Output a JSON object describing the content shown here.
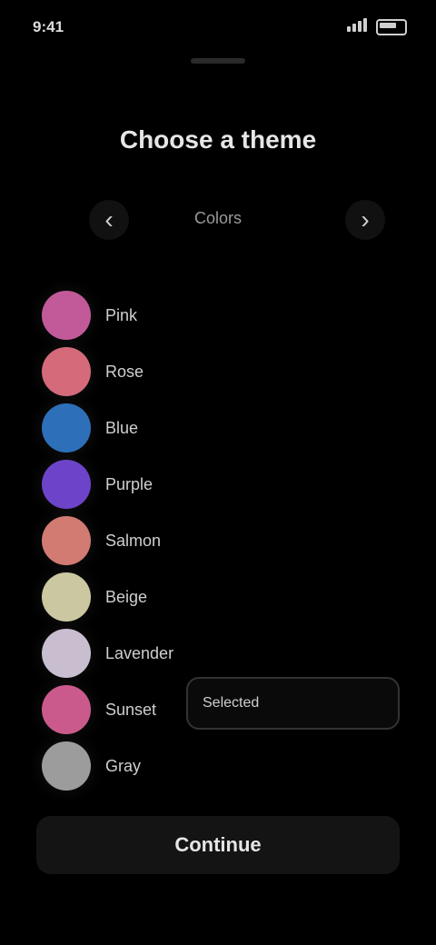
{
  "status": {
    "time": "9:41"
  },
  "sheet": {
    "title": "Choose a theme",
    "header": {
      "label": "Colors",
      "prev_icon": "chevron-left-icon",
      "next_icon": "chevron-right-icon"
    },
    "items": [
      {
        "label": "Pink",
        "color": "#c25a9a"
      },
      {
        "label": "Rose",
        "color": "#d46a7a"
      },
      {
        "label": "Blue",
        "color": "#2d6fb8"
      },
      {
        "label": "Purple",
        "color": "#6d44c9"
      },
      {
        "label": "Salmon",
        "color": "#d27b73"
      },
      {
        "label": "Beige",
        "color": "#cbc7a1"
      },
      {
        "label": "Lavender",
        "color": "#c8bed0"
      },
      {
        "label": "Sunset",
        "color": "#cb5a8c"
      },
      {
        "label": "Gray",
        "color": "#9c9c9c"
      }
    ],
    "tooltip": {
      "text": "Selected"
    },
    "primary_button": {
      "label": "Continue"
    }
  }
}
